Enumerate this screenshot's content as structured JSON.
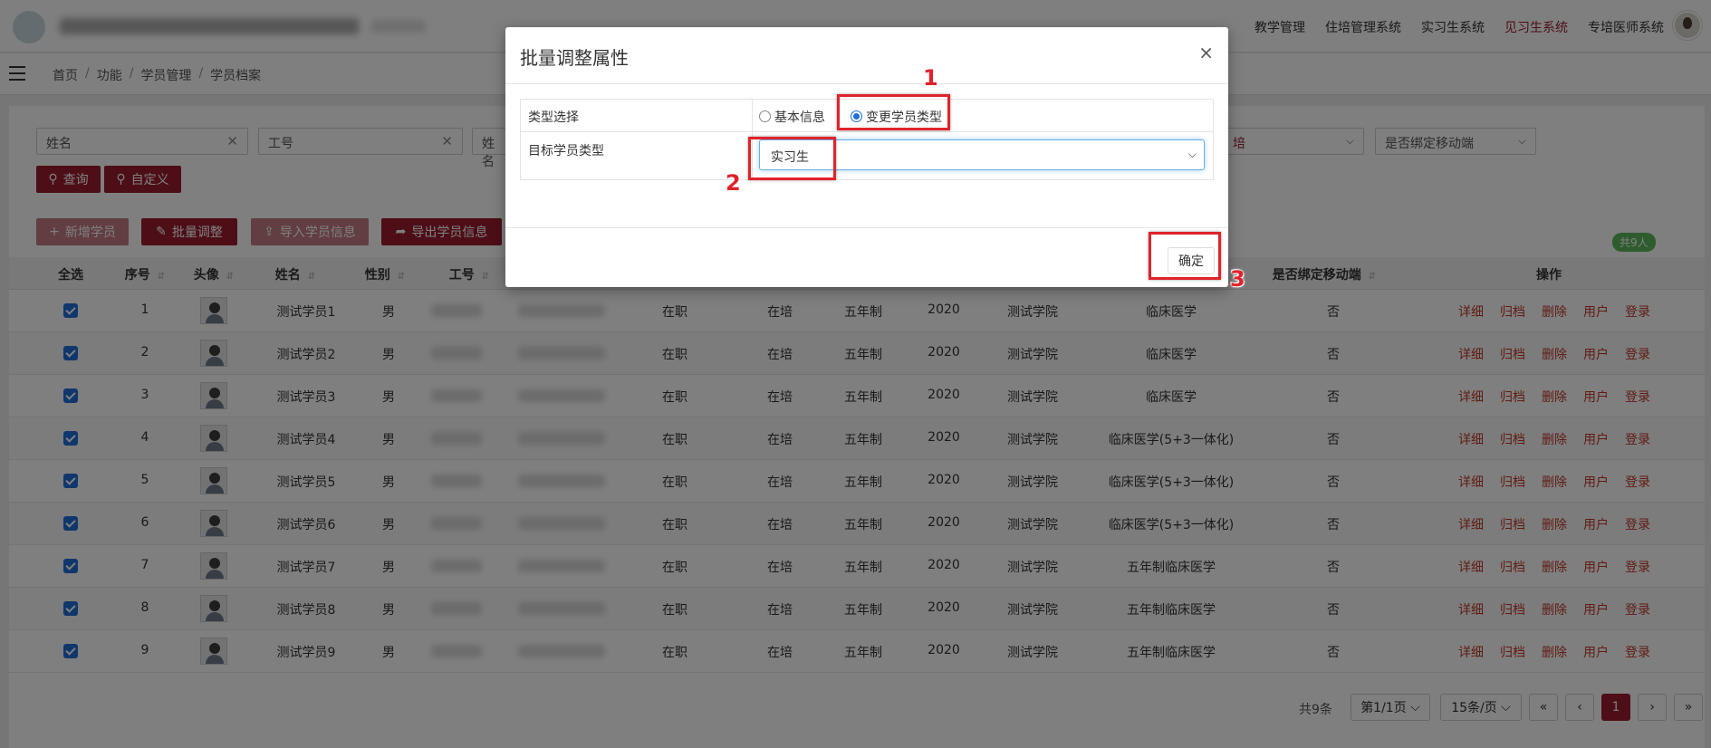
{
  "header": {
    "nav": [
      "教学管理",
      "住培管理系统",
      "实习生系统",
      "见习生系统",
      "专培医师系统"
    ],
    "active_nav": "见习生系统",
    "accent": "#9b1c2e"
  },
  "breadcrumb": [
    "首页",
    "功能",
    "学员管理",
    "学员档案"
  ],
  "filters": {
    "name_placeholder": "姓名",
    "id_placeholder": "工号",
    "third_placeholder": "姓名",
    "partial_select": "培",
    "mobile_bind_placeholder": "是否绑定移动端"
  },
  "toolbar": {
    "query": "查询",
    "custom": "自定义",
    "add": "新增学员",
    "batch": "批量调整",
    "import": "导入学员信息",
    "export": "导出学员信息",
    "count": "共9人"
  },
  "table": {
    "headers": {
      "select_all": "全选",
      "seq": "序号",
      "avatar": "头像",
      "name": "姓名",
      "gender": "性别",
      "id": "工号",
      "mobile": "是否绑定移动端",
      "ops": "操作"
    },
    "ops": [
      "详细",
      "归档",
      "删除",
      "用户",
      "登录"
    ],
    "rows": [
      {
        "seq": "1",
        "name": "测试学员1",
        "gender": "男",
        "job": "在职",
        "train": "在培",
        "system": "五年制",
        "year": "2020",
        "college": "测试学院",
        "major": "临床医学",
        "mobile": "否"
      },
      {
        "seq": "2",
        "name": "测试学员2",
        "gender": "男",
        "job": "在职",
        "train": "在培",
        "system": "五年制",
        "year": "2020",
        "college": "测试学院",
        "major": "临床医学",
        "mobile": "否"
      },
      {
        "seq": "3",
        "name": "测试学员3",
        "gender": "男",
        "job": "在职",
        "train": "在培",
        "system": "五年制",
        "year": "2020",
        "college": "测试学院",
        "major": "临床医学",
        "mobile": "否"
      },
      {
        "seq": "4",
        "name": "测试学员4",
        "gender": "男",
        "job": "在职",
        "train": "在培",
        "system": "五年制",
        "year": "2020",
        "college": "测试学院",
        "major": "临床医学(5+3一体化)",
        "mobile": "否"
      },
      {
        "seq": "5",
        "name": "测试学员5",
        "gender": "男",
        "job": "在职",
        "train": "在培",
        "system": "五年制",
        "year": "2020",
        "college": "测试学院",
        "major": "临床医学(5+3一体化)",
        "mobile": "否"
      },
      {
        "seq": "6",
        "name": "测试学员6",
        "gender": "男",
        "job": "在职",
        "train": "在培",
        "system": "五年制",
        "year": "2020",
        "college": "测试学院",
        "major": "临床医学(5+3一体化)",
        "mobile": "否"
      },
      {
        "seq": "7",
        "name": "测试学员7",
        "gender": "男",
        "job": "在职",
        "train": "在培",
        "system": "五年制",
        "year": "2020",
        "college": "测试学院",
        "major": "五年制临床医学",
        "mobile": "否"
      },
      {
        "seq": "8",
        "name": "测试学员8",
        "gender": "男",
        "job": "在职",
        "train": "在培",
        "system": "五年制",
        "year": "2020",
        "college": "测试学院",
        "major": "五年制临床医学",
        "mobile": "否"
      },
      {
        "seq": "9",
        "name": "测试学员9",
        "gender": "男",
        "job": "在职",
        "train": "在培",
        "system": "五年制",
        "year": "2020",
        "college": "测试学院",
        "major": "五年制临床医学",
        "mobile": "否"
      }
    ]
  },
  "pagination": {
    "total": "共9条",
    "page": "第1/1页",
    "page_size": "15条/页",
    "first": "«",
    "prev": "‹",
    "current": "1",
    "next": "›",
    "last": "»"
  },
  "modal": {
    "title": "批量调整属性",
    "close": "×",
    "type_label": "类型选择",
    "option_basic": "基本信息",
    "option_change": "变更学员类型",
    "selected_option": "变更学员类型",
    "target_label": "目标学员类型",
    "target_value": "实习生",
    "confirm": "确定"
  },
  "annotations": [
    "1",
    "2",
    "3"
  ]
}
